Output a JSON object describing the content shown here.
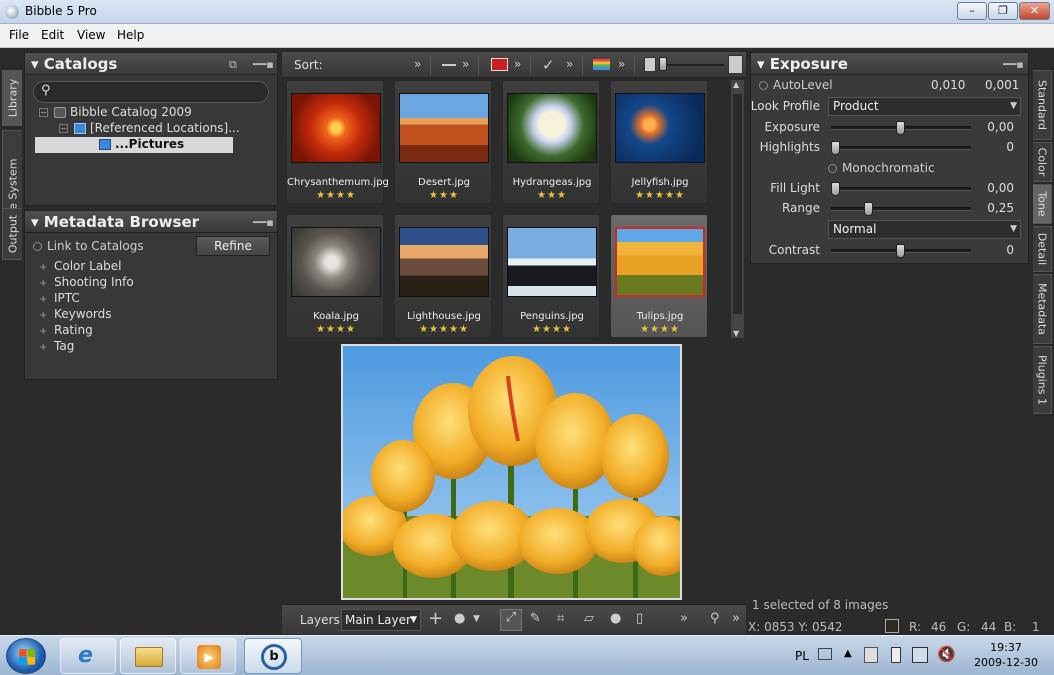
{
  "window": {
    "title": "Bibble 5 Pro"
  },
  "menu": [
    "File",
    "Edit",
    "View",
    "Help"
  ],
  "left_tabs": [
    "Library",
    "File System",
    "Output"
  ],
  "catalogs": {
    "title": "Catalogs",
    "tree": [
      {
        "label": "Bibble Catalog 2009",
        "expander": "−"
      },
      {
        "label": "[Referenced Locations]...",
        "expander": "−"
      },
      {
        "label": "...Pictures",
        "expander": ""
      }
    ]
  },
  "metadata": {
    "title": "Metadata Browser",
    "link_label": "Link to Catalogs",
    "refine_label": "Refine",
    "items": [
      "Color Label",
      "Shooting Info",
      "IPTC",
      "Keywords",
      "Rating",
      "Tag"
    ]
  },
  "sortbar": {
    "label": "Sort:",
    "chevron": "»",
    "label_color": "#c8201e"
  },
  "thumbnails": [
    {
      "name": "Chrysanthemum.jpg",
      "rating": 4,
      "stars": "★★★★"
    },
    {
      "name": "Desert.jpg",
      "rating": 3,
      "stars": "★★★"
    },
    {
      "name": "Hydrangeas.jpg",
      "rating": 3,
      "stars": "★★★"
    },
    {
      "name": "Jellyfish.jpg",
      "rating": 5,
      "stars": "★★★★★"
    },
    {
      "name": "Koala.jpg",
      "rating": 4,
      "stars": "★★★★"
    },
    {
      "name": "Lighthouse.jpg",
      "rating": 5,
      "stars": "★★★★★"
    },
    {
      "name": "Penguins.jpg",
      "rating": 4,
      "stars": "★★★★"
    },
    {
      "name": "Tulips.jpg",
      "rating": 4,
      "stars": "★★★★",
      "selected": true
    }
  ],
  "bottombar": {
    "layers_label": "Layers",
    "layer_value": "Main Layer",
    "chevron": "»"
  },
  "exposure": {
    "title": "Exposure",
    "autolevel": {
      "label": "AutoLevel",
      "value1": "0,010",
      "value2": "0,001"
    },
    "look_profile": {
      "label": "Look Profile",
      "value": "Product"
    },
    "exposure": {
      "label": "Exposure",
      "value": "0,00",
      "level": 0.5
    },
    "highlights": {
      "label": "Highlights",
      "value": "0",
      "level": 0.0
    },
    "monochromatic": "Monochromatic",
    "fill_light": {
      "label": "Fill Light",
      "value": "0,00",
      "level": 0.0
    },
    "range": {
      "label": "Range",
      "value": "0,25",
      "level": 0.25
    },
    "range_mode": "Normal",
    "contrast": {
      "label": "Contrast",
      "value": "0",
      "level": 0.5
    }
  },
  "right_tabs": [
    "Standard",
    "Color",
    "Tone",
    "Detail",
    "Metadata",
    "Plugins 1"
  ],
  "status": {
    "selected": "1 selected of 8 images",
    "coords": "X: 0853  Y: 0542",
    "r_label": "R:",
    "r": "46",
    "g_label": "G:",
    "g": "44",
    "b_label": "B:",
    "b": "1",
    "swatch_color": "#2e2a21"
  },
  "taskbar": {
    "lang": "PL",
    "time": "19:37",
    "date": "2009-12-30"
  }
}
